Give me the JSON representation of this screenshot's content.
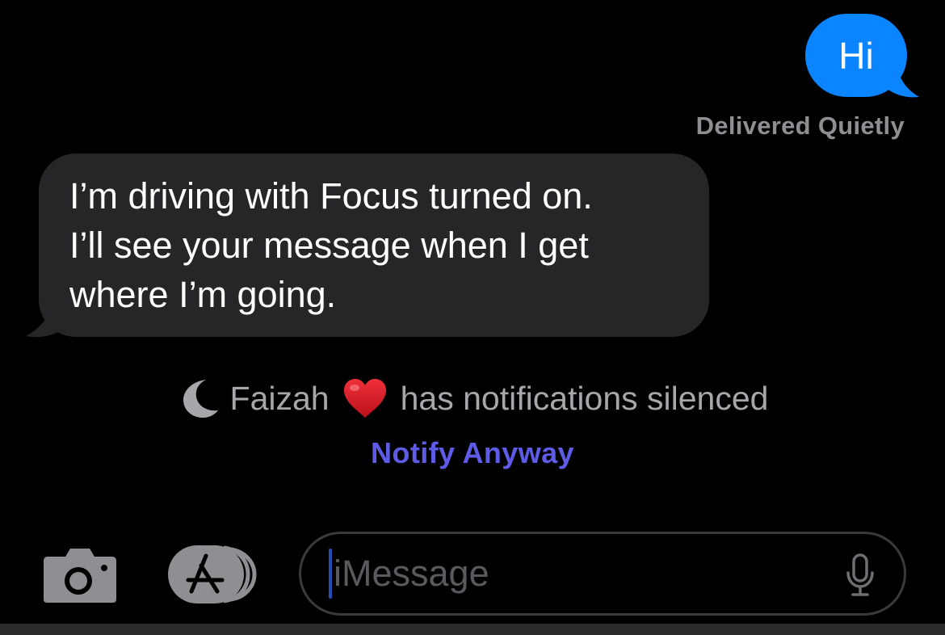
{
  "conversation": {
    "outgoing_message": "Hi",
    "delivery_status": "Delivered Quietly",
    "incoming_message": "I’m driving with Focus turned on.\nI’ll see your message when I get\nwhere I’m going."
  },
  "focus_status": {
    "contact_name": "Faizah",
    "contact_emoji": "heart-emoji",
    "status_text": "has notifications silenced",
    "action_label": "Notify Anyway",
    "icon": "moon-icon"
  },
  "input_bar": {
    "camera_icon": "camera-icon",
    "apps_icon": "app-store-icon",
    "placeholder": "iMessage",
    "mic_icon": "microphone-icon"
  },
  "colors": {
    "outgoing_bubble": "#0a84ff",
    "incoming_bubble": "#262628",
    "secondary_text": "#8e8e93",
    "notify_link": "#5e5ce6",
    "background": "#000000"
  }
}
